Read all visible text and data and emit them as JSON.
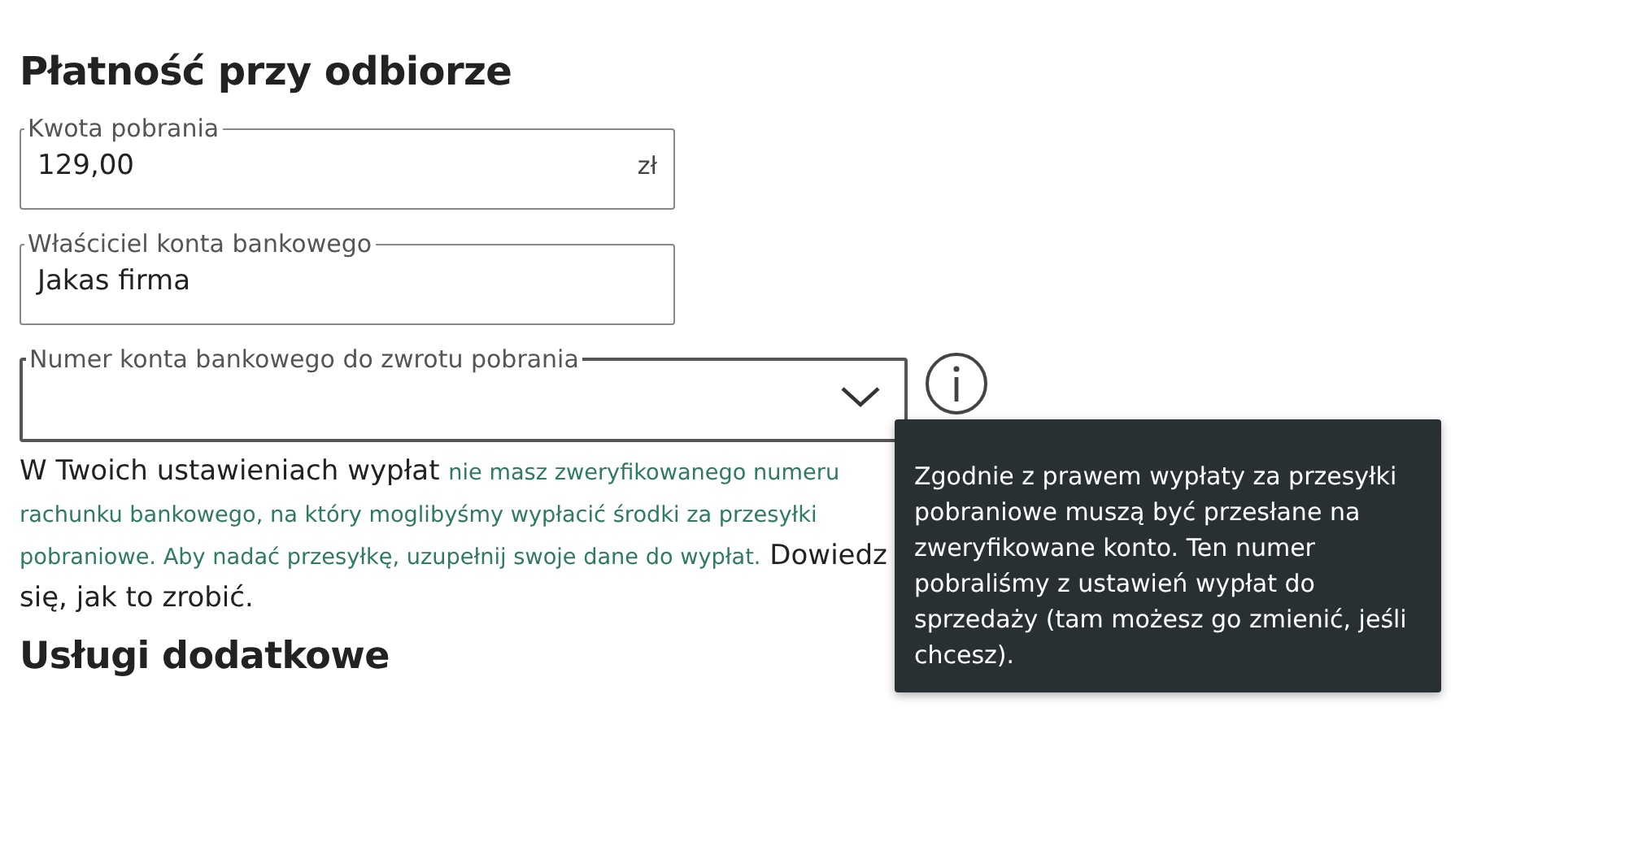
{
  "heading": "Płatność przy odbiorze",
  "fields": [
    {
      "kind": "text",
      "label": "Kwota pobrania",
      "value": "129,00",
      "suffix": "zł"
    },
    {
      "kind": "text",
      "label": "Właściciel konta bankowego",
      "value": "Jakas firma"
    },
    {
      "kind": "select",
      "label": "Numer konta bankowego do zwrotu pobrania"
    }
  ],
  "notice": [
    {
      "kind": "plain",
      "text": "W Twoich ustawieniach wypłat "
    },
    {
      "kind": "highlight",
      "text": "nie masz zweryfikowanego numeru rachunku bankowego, na który moglibyśmy wypłacić środki za przesyłki pobraniowe. Aby nadać przesyłkę, uzupełnij swoje dane do wypłat."
    },
    {
      "kind": "plain",
      "text": " Dowiedz się, jak to zrobić."
    }
  ],
  "tooltip": "Zgodnie z prawem wypłaty za przesyłki pobraniowe muszą być przesłane na zweryfikowane konto. Ten numer pobraliśmy z ustawień wypłat do sprzedaży (tam możesz go zmienić, jeśli chcesz).",
  "section_heading": "Usługi dodatkowe"
}
